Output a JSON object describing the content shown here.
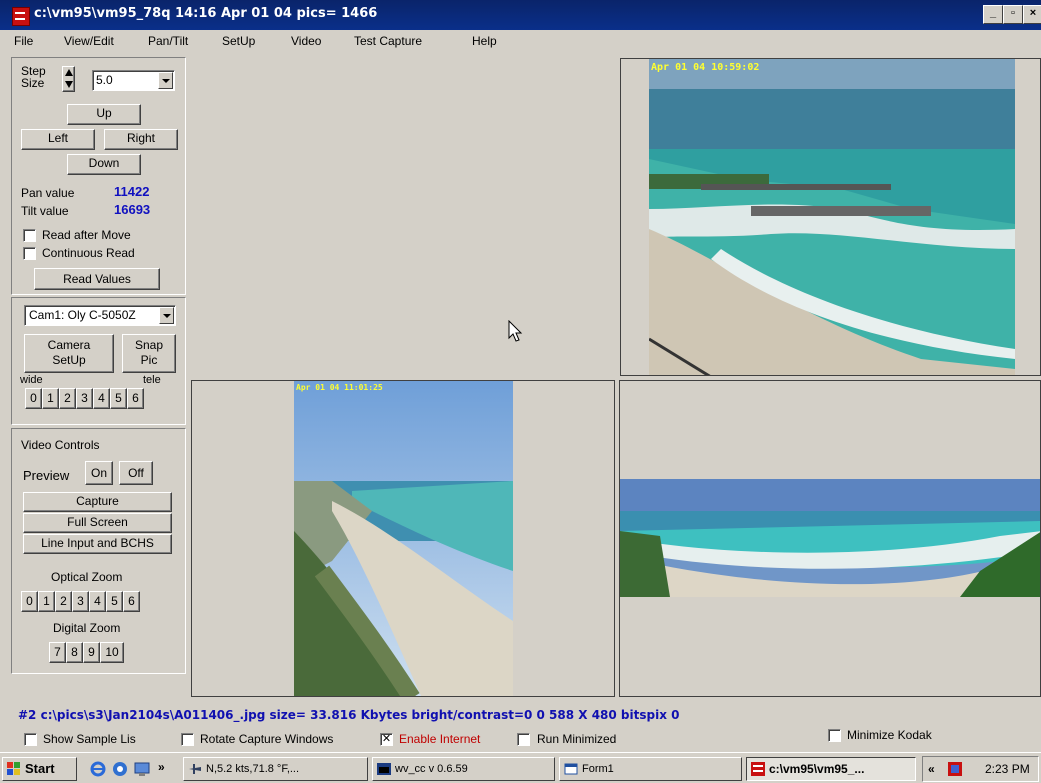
{
  "window": {
    "title": "c:\\vm95\\vm95_78q  14:16  Apr 01 04   pics= 1466",
    "min": "_",
    "max": "8",
    "close": "×"
  },
  "menu": [
    "File",
    "View/Edit",
    "Pan/Tilt",
    "SetUp",
    "Video",
    "Test Capture",
    "Help"
  ],
  "pantilt": {
    "step_label_1": "Step",
    "step_label_2": "Size",
    "step_value": "5.0",
    "up": "Up",
    "left": "Left",
    "right": "Right",
    "down": "Down",
    "pan_label": "Pan value",
    "pan_value": "11422",
    "tilt_label": "Tilt value",
    "tilt_value": "16693",
    "read_after_move": "Read after Move",
    "continuous_read": "Continuous Read",
    "read_values": "Read Values"
  },
  "camera": {
    "selected": "Cam1: Oly C-5050Z",
    "camera_setup_1": "Camera",
    "camera_setup_2": "SetUp",
    "snap_1": "Snap",
    "snap_2": "Pic",
    "wide": "wide",
    "tele": "tele",
    "zoom": [
      "0",
      "1",
      "2",
      "3",
      "4",
      "5",
      "6"
    ]
  },
  "video": {
    "group": "Video Controls",
    "preview": "Preview",
    "on": "On",
    "off": "Off",
    "capture": "Capture",
    "full_screen": "Full Screen",
    "line_input": "Line Input and BCHS",
    "optical_zoom": "Optical Zoom",
    "optical": [
      "0",
      "1",
      "2",
      "3",
      "4",
      "5",
      "6"
    ],
    "digital_zoom": "Digital Zoom",
    "digital": [
      "7",
      "8",
      "9",
      "10"
    ]
  },
  "images": {
    "stamp_top_right": "Apr 01 04 10:59:02",
    "stamp_mid": "Apr 01 04 11:01:25"
  },
  "status": {
    "text": "#2  c:\\pics\\s3\\Jan2104s\\A011406_.jpg size= 33.816 Kbytes bright/contrast=0 0 588 X 480 bitspix 0",
    "show_sample": "Show Sample Lis",
    "rotate": "Rotate Capture Windows",
    "enable_internet": "Enable Internet",
    "run_minimized": "Run Minimized",
    "minimize_kodak": "Minimize Kodak"
  },
  "taskbar": {
    "start": "Start",
    "chevron": "»",
    "tasks": [
      "N,5.2 kts,71.8 °F,...",
      "wv_cc v 0.6.59",
      "Form1",
      "c:\\vm95\\vm95_..."
    ],
    "tray_chevron": "«",
    "clock": "2:23 PM"
  },
  "colors": {
    "title_bar": "#0a246a",
    "value_blue": "#1010c0",
    "enable_red": "#c00000",
    "stamp_yellow": "#ffff30"
  }
}
